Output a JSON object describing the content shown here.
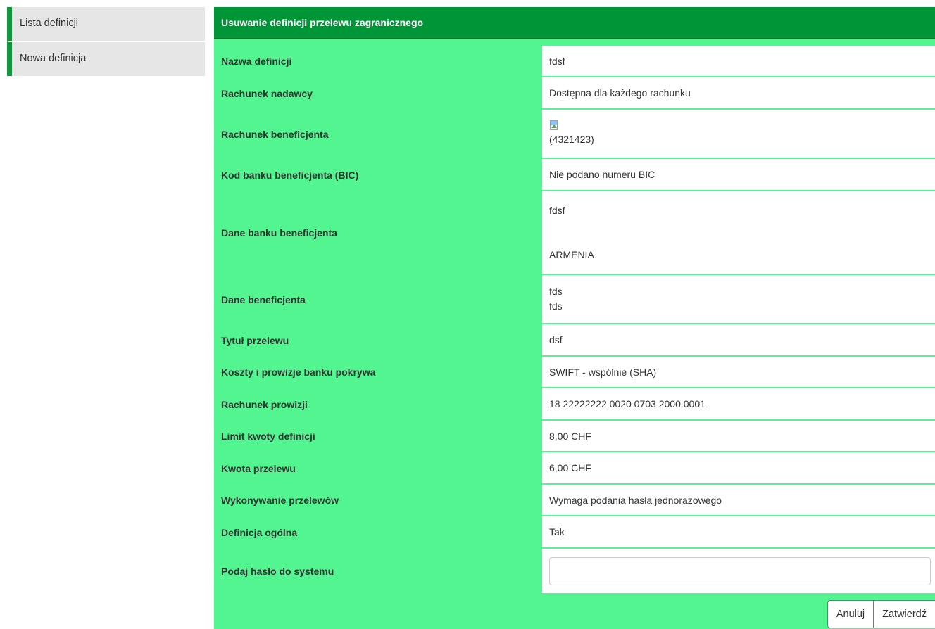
{
  "sidebar": {
    "items": [
      {
        "label": "Lista definicji"
      },
      {
        "label": "Nowa definicja"
      }
    ]
  },
  "panel": {
    "title": "Usuwanie definicji przelewu zagranicznego",
    "fields": [
      {
        "label": "Nazwa definicji",
        "lines": [
          "fdsf"
        ]
      },
      {
        "label": "Rachunek nadawcy",
        "lines": [
          "Dostępna dla każdego rachunku"
        ]
      },
      {
        "label": "Rachunek beneficjenta",
        "image": "broken-image-icon",
        "lines": [
          "(4321423)"
        ]
      },
      {
        "label": "Kod banku beneficjenta (BIC)",
        "lines": [
          "Nie podano numeru BIC"
        ]
      },
      {
        "label": "Dane banku beneficjenta",
        "lines": [
          "fdsf",
          "",
          "",
          "ARMENIA"
        ]
      },
      {
        "label": "Dane beneficjenta",
        "lines": [
          "fds",
          "fds"
        ]
      },
      {
        "label": "Tytuł przelewu",
        "lines": [
          "dsf"
        ]
      },
      {
        "label": "Koszty i prowizje banku pokrywa",
        "lines": [
          "SWIFT - wspólnie (SHA)"
        ]
      },
      {
        "label": "Rachunek prowizji",
        "lines": [
          "18 22222222 0020 0703 2000 0001"
        ]
      },
      {
        "label": "Limit kwoty definicji",
        "lines": [
          "8,00 CHF"
        ]
      },
      {
        "label": "Kwota przelewu",
        "lines": [
          "6,00 CHF"
        ]
      },
      {
        "label": "Wykonywanie przelewów",
        "lines": [
          "Wymaga podania hasła jednorazowego"
        ]
      },
      {
        "label": "Definicja ogólna",
        "lines": [
          "Tak"
        ]
      }
    ],
    "password": {
      "label": "Podaj hasło do systemu",
      "value": "",
      "placeholder": ""
    },
    "buttons": {
      "cancel": "Anuluj",
      "confirm": "Zatwierdź"
    }
  },
  "colors": {
    "header": "#009637",
    "panel_bg": "#52f58f",
    "sidebar_accent": "#14943d",
    "sidebar_bg": "#e6e6e6"
  }
}
